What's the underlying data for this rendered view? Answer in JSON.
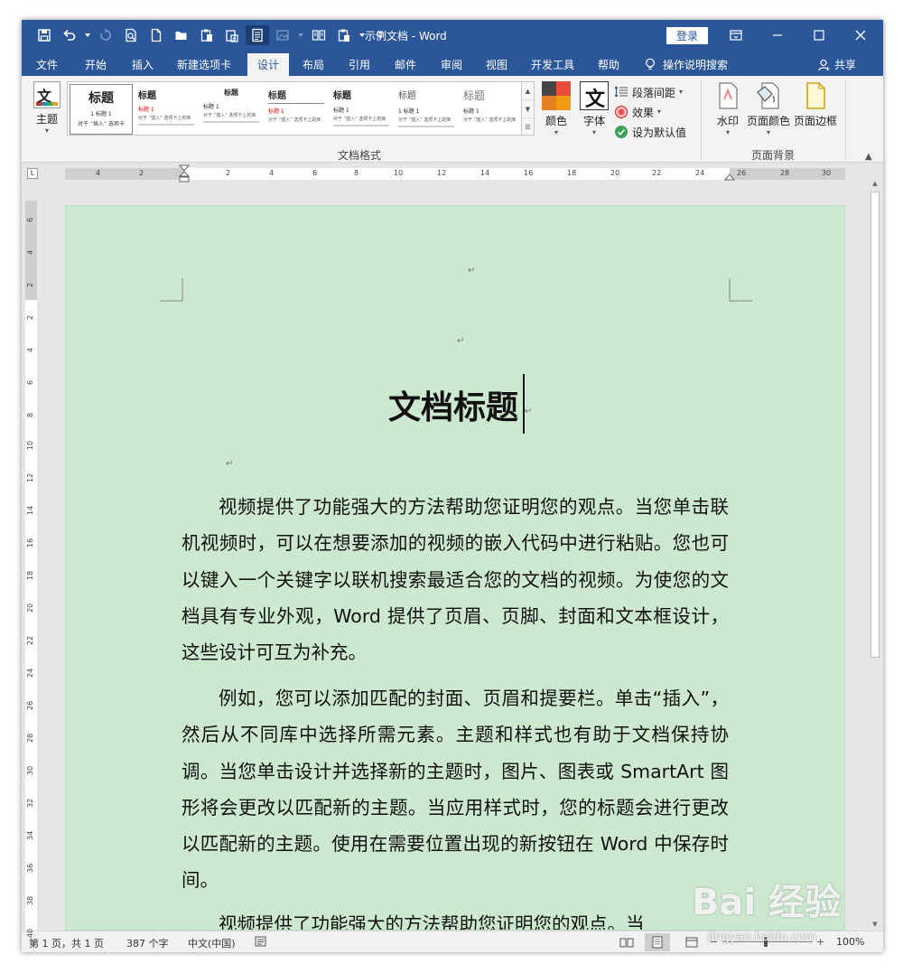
{
  "window": {
    "title": "示例文档 - Word",
    "login_label": "登录",
    "controls": [
      "ribbon-display-icon",
      "minimize-icon",
      "maximize-icon",
      "close-icon"
    ]
  },
  "quick_access": [
    "save-icon",
    "undo-icon",
    "redo-icon",
    "print-preview-icon",
    "new-document-icon",
    "open-icon",
    "paste-icon",
    "paste-special-icon",
    "read-mode-icon",
    "image-icon",
    "side-by-side-icon",
    "clipboard-icon",
    "customize-qat-icon"
  ],
  "tabs": [
    {
      "label": "文件",
      "active": false
    },
    {
      "label": "开始",
      "active": false
    },
    {
      "label": "插入",
      "active": false
    },
    {
      "label": "新建选项卡",
      "active": false
    },
    {
      "label": "设计",
      "active": true
    },
    {
      "label": "布局",
      "active": false
    },
    {
      "label": "引用",
      "active": false
    },
    {
      "label": "邮件",
      "active": false
    },
    {
      "label": "审阅",
      "active": false
    },
    {
      "label": "视图",
      "active": false
    },
    {
      "label": "开发工具",
      "active": false
    },
    {
      "label": "帮助",
      "active": false
    }
  ],
  "tell_me": "操作说明搜索",
  "share": "共享",
  "ribbon": {
    "theme_label": "主题",
    "theme_icon_text": "文",
    "gallery": [
      {
        "title": "标题",
        "heading": "1 标题 1",
        "text": "对于 “插入” 选项卡"
      },
      {
        "title": "标题",
        "heading": "标题 1",
        "text": "对于 “插入” 选项卡上的库"
      },
      {
        "title": "标题",
        "heading": "标题 1",
        "text": "对于 “插入” 选项卡上的库"
      },
      {
        "title": "标题",
        "heading": "标题 1",
        "text": "对于 “插入” 选项卡上的库"
      },
      {
        "title": "标题",
        "heading": "标题 1",
        "text": "对于 “插入” 选项卡上的库"
      },
      {
        "title": "标题",
        "heading": "1 标题 1",
        "text": "对于 “插入” 选项卡上的库"
      },
      {
        "title": "标题",
        "heading": "标题 1",
        "text": "对于 “插入” 选项卡上的库"
      }
    ],
    "colors_label": "颜色",
    "fonts_label": "字体",
    "fonts_icon_text": "文",
    "paragraph_spacing_label": "段落间距",
    "effects_label": "效果",
    "set_default_label": "设为默认值",
    "document_format_group": "文档格式",
    "watermark_label": "水印",
    "page_color_label": "页面颜色",
    "page_borders_label": "页面边框",
    "page_background_group": "页面背景"
  },
  "hruler_ticks": [
    "4",
    "2",
    "2",
    "4",
    "6",
    "8",
    "10",
    "12",
    "14",
    "16",
    "18",
    "20",
    "22",
    "24",
    "26",
    "28",
    "30"
  ],
  "vruler_ticks": [
    "6",
    "4",
    "2",
    "2",
    "4",
    "6",
    "8",
    "10",
    "12",
    "14",
    "16",
    "18",
    "20",
    "22",
    "24",
    "26",
    "28",
    "30",
    "32",
    "34",
    "36",
    "38",
    "40"
  ],
  "document": {
    "title": "文档标题",
    "paragraphs": [
      "视频提供了功能强大的方法帮助您证明您的观点。当您单击联机视频时，可以在想要添加的视频的嵌入代码中进行粘贴。您也可以键入一个关键字以联机搜索最适合您的文档的视频。为使您的文档具有专业外观，Word 提供了页眉、页脚、封面和文本框设计，这些设计可互为补充。",
      "例如，您可以添加匹配的封面、页眉和提要栏。单击“插入”，然后从不同库中选择所需元素。主题和样式也有助于文档保持协调。当您单击设计并选择新的主题时，图片、图表或 SmartArt 图形将会更改以匹配新的主题。当应用样式时，您的标题会进行更改以匹配新的主题。使用在需要位置出现的新按钮在 Word 中保存时间。",
      "视频提供了功能强大的方法帮助您证明您的观点。当"
    ],
    "page_color": "#cce8cf"
  },
  "status": {
    "page": "第 1 页，共 1 页",
    "words": "387 个字",
    "language": "中文(中国)",
    "zoom": "100%"
  },
  "watermark": {
    "text": "Bai 经验",
    "url": "jingyan.baidu.com"
  },
  "colors": {
    "brand": "#2b579a",
    "ribbon_bg": "#f3f3f3",
    "page_bg": "#cce8cf"
  }
}
